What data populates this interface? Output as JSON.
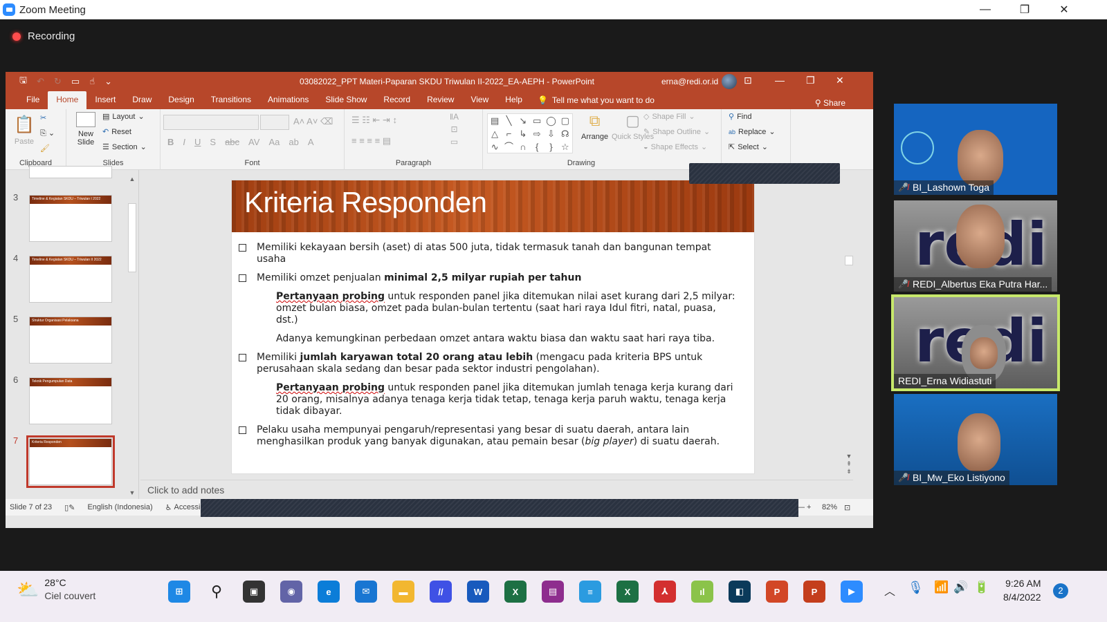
{
  "zoom": {
    "title": "Zoom Meeting",
    "recording_label": "Recording",
    "controls": {
      "minimize": "—",
      "restore": "❐",
      "close": "✕"
    }
  },
  "powerpoint": {
    "document_title": "03082022_PPT Materi-Paparan SKDU Triwulan II-2022_EA-AEPH  -  PowerPoint",
    "user_email": "erna@redi.or.id",
    "tabs": [
      "File",
      "Home",
      "Insert",
      "Draw",
      "Design",
      "Transitions",
      "Animations",
      "Slide Show",
      "Record",
      "Review",
      "View",
      "Help"
    ],
    "active_tab": "Home",
    "tell_me": "Tell me what you want to do",
    "share": "Share",
    "ribbon": {
      "clipboard": {
        "label": "Clipboard",
        "paste": "Paste"
      },
      "slides": {
        "label": "Slides",
        "new_slide": "New Slide",
        "layout": "Layout",
        "reset": "Reset",
        "section": "Section"
      },
      "font": {
        "label": "Font"
      },
      "paragraph": {
        "label": "Paragraph"
      },
      "drawing": {
        "label": "Drawing",
        "arrange": "Arrange",
        "quick_styles": "Quick Styles",
        "shape_fill": "Shape Fill",
        "shape_outline": "Shape Outline",
        "shape_effects": "Shape Effects"
      },
      "editing": {
        "find": "Find",
        "replace": "Replace",
        "select": "Select"
      }
    },
    "thumbnails": [
      {
        "num": "3",
        "title": "Timeline & Kegiatan SKDU – Triwulan I 2022"
      },
      {
        "num": "4",
        "title": "Timeline & Kegiatan SKDU – Triwulan II 2022"
      },
      {
        "num": "5",
        "title": "Struktur Organisasi Pelaksana"
      },
      {
        "num": "6",
        "title": "Teknik Pengumpulan Data"
      },
      {
        "num": "7",
        "title": "Kriteria Responden",
        "selected": true
      }
    ],
    "slide": {
      "title": "Kriteria Responden",
      "b1": "Memiliki kekayaan bersih (aset) di atas 500 juta, tidak termasuk tanah dan bangunan tempat  usaha",
      "b2_pre": "Memiliki omzet penjualan ",
      "b2_bold": "minimal 2,5 milyar rupiah per tahun",
      "s1_bold": "Pertanyaan probing",
      "s1_text": " untuk responden panel jika ditemukan nilai aset kurang dari 2,5 milyar: omzet bulan biasa, omzet pada bulan-bulan tertentu (saat hari raya Idul fitri, natal, puasa, dst.)",
      "s2": "Adanya kemungkinan perbedaan omzet antara waktu biasa dan waktu saat hari raya tiba.",
      "b3_pre": "Memiliki ",
      "b3_bold": "jumlah karyawan total 20 orang atau lebih",
      "b3_post": " (mengacu pada kriteria BPS untuk perusahaan skala sedang dan besar pada sektor industri pengolahan).",
      "s3_bold": "Pertanyaan probing",
      "s3_text": " untuk responden panel jika ditemukan jumlah tenaga kerja kurang dari 20 orang, misalnya adanya tenaga kerja tidak tetap, tenaga kerja paruh waktu, tenaga kerja tidak dibayar.",
      "b4_pre": "Pelaku usaha mempunyai pengaruh/representasi yang besar di suatu daerah, antara lain menghasilkan produk yang banyak digunakan, atau pemain besar (",
      "b4_italic": "big player",
      "b4_post": ") di suatu daerah."
    },
    "notes_placeholder": "Click to add notes",
    "status": {
      "slide": "Slide 7 of 23",
      "language": "English (Indonesia)",
      "accessibility": "Accessibility:",
      "zoom": "82%"
    }
  },
  "participants": [
    {
      "name": "BI_Lashown Toga",
      "muted": true
    },
    {
      "name": "REDI_Albertus Eka Putra Har...",
      "muted": true
    },
    {
      "name": "REDI_Erna Widiastuti",
      "muted": false,
      "active_speaker": true
    },
    {
      "name": "BI_Mw_Eko Listiyono",
      "muted": true
    }
  ],
  "taskbar": {
    "weather_temp": "28°C",
    "weather_desc": "Ciel couvert",
    "time": "9:26 AM",
    "date": "8/4/2022",
    "notifications": "2",
    "apps": [
      "start",
      "search",
      "task-view",
      "teams-chat",
      "edge",
      "mail",
      "file-explorer",
      "app-blue",
      "word",
      "excel-green",
      "winrar",
      "notepad",
      "excel",
      "acrobat",
      "chart-app",
      "app-teal",
      "powerpoint-round",
      "powerpoint",
      "zoom"
    ]
  }
}
